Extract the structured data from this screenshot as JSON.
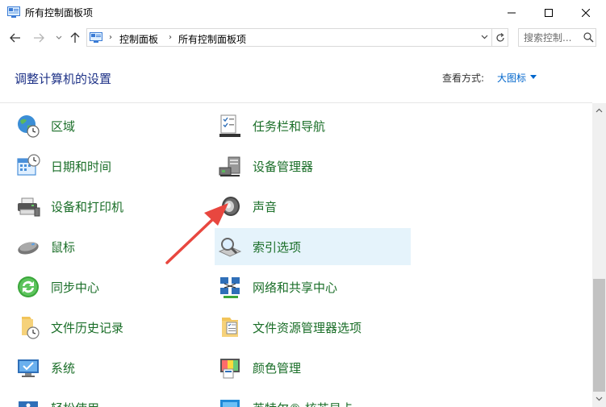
{
  "window": {
    "title": "所有控制面板项"
  },
  "address_bar": {
    "breadcrumbs": [
      "控制面板",
      "所有控制面板项"
    ],
    "search_placeholder": "搜索控制..."
  },
  "header": {
    "title": "调整计算机的设置",
    "view_by_label": "查看方式:",
    "view_by_value": "大图标"
  },
  "items_left": [
    {
      "label": "区域",
      "icon": "globe-clock-icon"
    },
    {
      "label": "日期和时间",
      "icon": "calendar-clock-icon"
    },
    {
      "label": "设备和打印机",
      "icon": "printer-icon"
    },
    {
      "label": "鼠标",
      "icon": "mouse-icon"
    },
    {
      "label": "同步中心",
      "icon": "sync-icon"
    },
    {
      "label": "文件历史记录",
      "icon": "folder-clock-icon"
    },
    {
      "label": "系统",
      "icon": "monitor-check-icon"
    },
    {
      "label": "轻松使用",
      "icon": "accessibility-icon"
    }
  ],
  "items_right": [
    {
      "label": "任务栏和导航",
      "icon": "taskbar-checklist-icon"
    },
    {
      "label": "设备管理器",
      "icon": "device-manager-icon"
    },
    {
      "label": "声音",
      "icon": "speaker-icon"
    },
    {
      "label": "索引选项",
      "icon": "index-search-icon",
      "highlighted": true
    },
    {
      "label": "网络和共享中心",
      "icon": "network-icon"
    },
    {
      "label": "文件资源管理器选项",
      "icon": "folder-options-icon"
    },
    {
      "label": "颜色管理",
      "icon": "color-management-icon"
    },
    {
      "label": "英特尔® 核芯显卡",
      "icon": "intel-graphics-icon"
    }
  ],
  "colors": {
    "link_green": "#1a6e28",
    "header_blue": "#1e3287",
    "highlight": "#e5f3fb",
    "arrow_red": "#e8473f"
  }
}
